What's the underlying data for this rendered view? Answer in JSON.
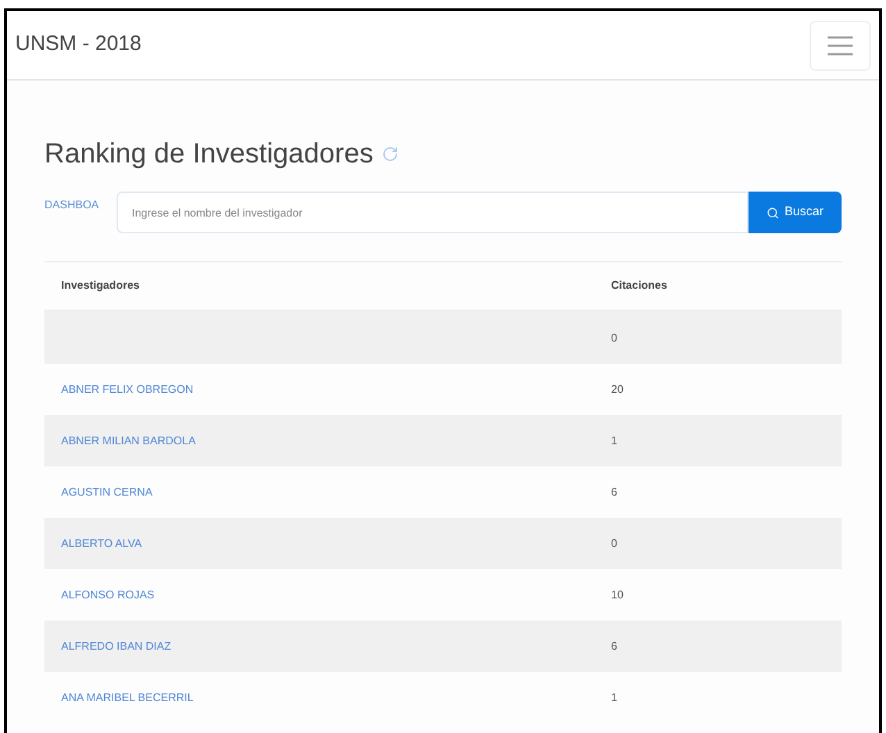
{
  "navbar": {
    "brand": "UNSM - 2018"
  },
  "page": {
    "title": "Ranking de Investigadores"
  },
  "search": {
    "label": "DASHBOA",
    "placeholder": "Ingrese el nombre del investigador",
    "button": "Buscar"
  },
  "table": {
    "columns": [
      "Investigadores",
      "Citaciones"
    ],
    "rows": [
      {
        "name": "",
        "citations": "0"
      },
      {
        "name": "ABNER FELIX OBREGON",
        "citations": "20"
      },
      {
        "name": "ABNER MILIAN BARDOLA",
        "citations": "1"
      },
      {
        "name": "AGUSTIN CERNA",
        "citations": "6"
      },
      {
        "name": "ALBERTO ALVA",
        "citations": "0"
      },
      {
        "name": "ALFONSO ROJAS",
        "citations": "10"
      },
      {
        "name": "ALFREDO IBAN DIAZ",
        "citations": "6"
      },
      {
        "name": "ANA MARIBEL BECERRIL",
        "citations": "1"
      }
    ]
  }
}
